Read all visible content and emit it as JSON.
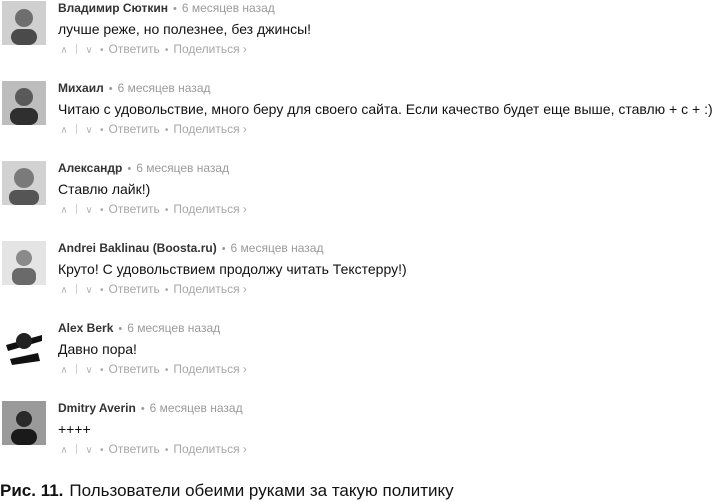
{
  "comments": [
    {
      "author": "Владимир Сюткин",
      "time": "6 месяцев назад",
      "text": "лучше реже, но полезнее, без джинсы!",
      "avatar_icon": "user-avatar-icon"
    },
    {
      "author": "Михаил",
      "time": "6 месяцев назад",
      "text": "Читаю с удовольствие, много беру для своего сайта. Если качество будет еще выше, ставлю + с + :)",
      "avatar_icon": "user-avatar-icon"
    },
    {
      "author": "Александр",
      "time": "6 месяцев назад",
      "text": "Ставлю лайк!)",
      "avatar_icon": "user-avatar-icon"
    },
    {
      "author": "Andrei Baklinau (Boosta.ru)",
      "time": "6 месяцев назад",
      "text": "Круто! С удовольствием продолжу читать Текстерру!)",
      "avatar_icon": "user-avatar-icon"
    },
    {
      "author": "Alex Berk",
      "time": "6 месяцев назад",
      "text": "Давно пора!",
      "avatar_icon": "user-avatar-icon"
    },
    {
      "author": "Dmitry Averin",
      "time": "6 месяцев назад",
      "text": "++++",
      "avatar_icon": "user-avatar-icon"
    }
  ],
  "actions": {
    "reply": "Ответить",
    "share": "Поделиться ›",
    "upvote_icon": "chevron-up-icon",
    "downvote_icon": "chevron-down-icon"
  },
  "caption": {
    "number": "Рис. 11.",
    "text": "Пользователи обеими руками за такую политику"
  }
}
